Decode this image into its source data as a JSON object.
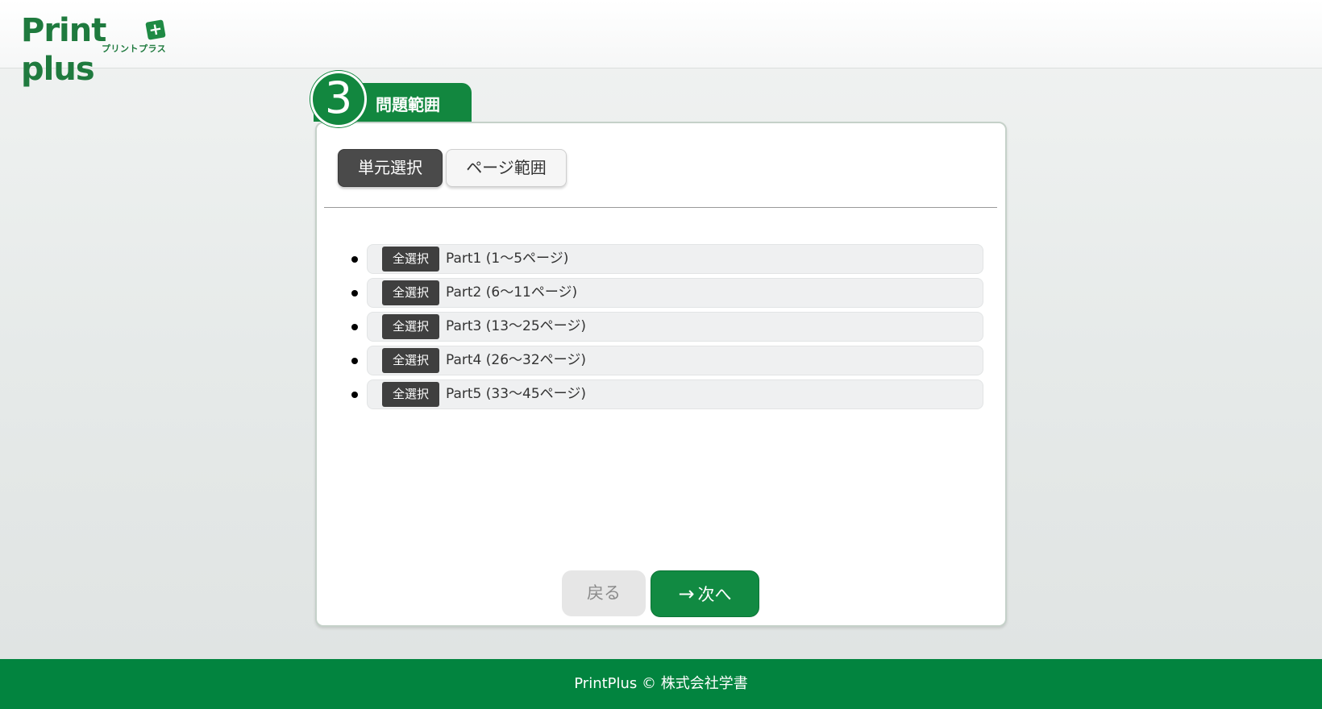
{
  "header": {
    "logo_text": "Print plus",
    "logo_plus": "+",
    "logo_sub": "プリントプラス"
  },
  "step": {
    "number": "3",
    "title": "問題範囲"
  },
  "mode_tabs": [
    {
      "label": "単元選択",
      "active": true
    },
    {
      "label": "ページ範囲",
      "active": false
    }
  ],
  "units": [
    {
      "button_label": "全選択",
      "label": "Part1 (1〜5ページ)"
    },
    {
      "button_label": "全選択",
      "label": "Part2 (6〜11ページ)"
    },
    {
      "button_label": "全選択",
      "label": "Part3 (13〜25ページ)"
    },
    {
      "button_label": "全選択",
      "label": "Part4 (26〜32ページ)"
    },
    {
      "button_label": "全選択",
      "label": "Part5 (33〜45ページ)"
    }
  ],
  "nav": {
    "back_label": "戻る",
    "next_arrow": "→",
    "next_label": "次へ"
  },
  "footer": {
    "text": "PrintPlus © 株式会社学書"
  },
  "colors": {
    "brand_green": "#12873f",
    "footer_green": "#02843f",
    "dark_button": "#4a4a4a"
  }
}
